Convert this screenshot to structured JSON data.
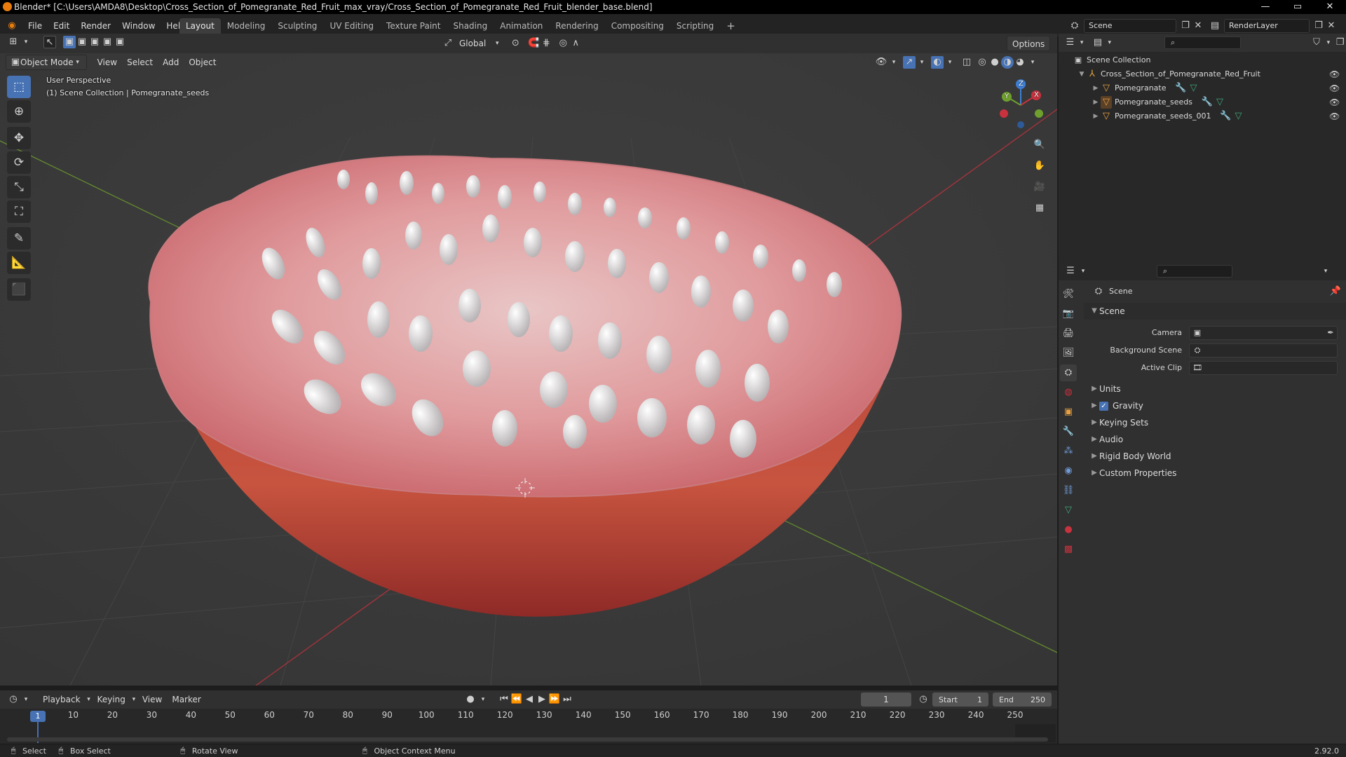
{
  "title_bar": {
    "title": "Blender* [C:\\Users\\AMDA8\\Desktop\\Cross_Section_of_Pomegranate_Red_Fruit_max_vray/Cross_Section_of_Pomegranate_Red_Fruit_blender_base.blend]",
    "minimize": "—",
    "maximize": "▭",
    "close": "✕"
  },
  "menu": [
    "File",
    "Edit",
    "Render",
    "Window",
    "Help"
  ],
  "workspaces": [
    "Layout",
    "Modeling",
    "Sculpting",
    "UV Editing",
    "Texture Paint",
    "Shading",
    "Animation",
    "Rendering",
    "Compositing",
    "Scripting"
  ],
  "workspace_add": "+",
  "scene": {
    "name": "Scene",
    "view_layer": "RenderLayer"
  },
  "tool_header": {
    "orientation": "Global",
    "options": "Options"
  },
  "viewport_header": {
    "mode": "Object Mode",
    "menus": [
      "View",
      "Select",
      "Add",
      "Object"
    ]
  },
  "viewport": {
    "perspective": "User Perspective",
    "collection": "(1) Scene Collection | Pomegranate_seeds",
    "gizmo": {
      "x": "X",
      "y": "Y",
      "z": "Z"
    }
  },
  "tools": [
    {
      "name": "select-box-tool",
      "glyph": "⬚"
    },
    {
      "name": "cursor-tool",
      "glyph": "⊕"
    },
    {
      "name": "move-tool",
      "glyph": "✥"
    },
    {
      "name": "rotate-tool",
      "glyph": "⟳"
    },
    {
      "name": "scale-tool",
      "glyph": "⤡"
    },
    {
      "name": "transform-tool",
      "glyph": "⛶"
    },
    {
      "name": "annotate-tool",
      "glyph": "✎"
    },
    {
      "name": "measure-tool",
      "glyph": "📐"
    },
    {
      "name": "add-cube-tool",
      "glyph": "⬛"
    }
  ],
  "timeline": {
    "menus": [
      "Playback",
      "Keying",
      "View",
      "Marker"
    ],
    "current_frame": "1",
    "start_label": "Start",
    "start": "1",
    "end_label": "End",
    "end": "250",
    "ticks": [
      "10",
      "20",
      "30",
      "40",
      "50",
      "60",
      "70",
      "80",
      "90",
      "100",
      "110",
      "120",
      "130",
      "140",
      "150",
      "160",
      "170",
      "180",
      "190",
      "200",
      "210",
      "220",
      "230",
      "240",
      "250"
    ],
    "playhead": "1"
  },
  "status_bar": {
    "select": "Select",
    "box_select": "Box Select",
    "rotate_view": "Rotate View",
    "context_menu": "Object Context Menu",
    "version": "2.92.0"
  },
  "outliner": {
    "root": "Scene Collection",
    "collection": "Cross_Section_of_Pomegranate_Red_Fruit",
    "objects": [
      "Pomegranate",
      "Pomegranate_seeds",
      "Pomegranate_seeds_001"
    ]
  },
  "properties": {
    "context": "Scene",
    "panel_title": "Scene",
    "fields": [
      {
        "label": "Camera",
        "value": ""
      },
      {
        "label": "Background Scene",
        "value": ""
      },
      {
        "label": "Active Clip",
        "value": ""
      }
    ],
    "panels": [
      "Units",
      "Gravity",
      "Keying Sets",
      "Audio",
      "Rigid Body World",
      "Custom Properties"
    ],
    "gravity_checked": "✓"
  },
  "colors": {
    "accent": "#4772b3",
    "axis_x": "#c8323e",
    "axis_y": "#6fa02d",
    "axis_z": "#3d7fd6"
  }
}
